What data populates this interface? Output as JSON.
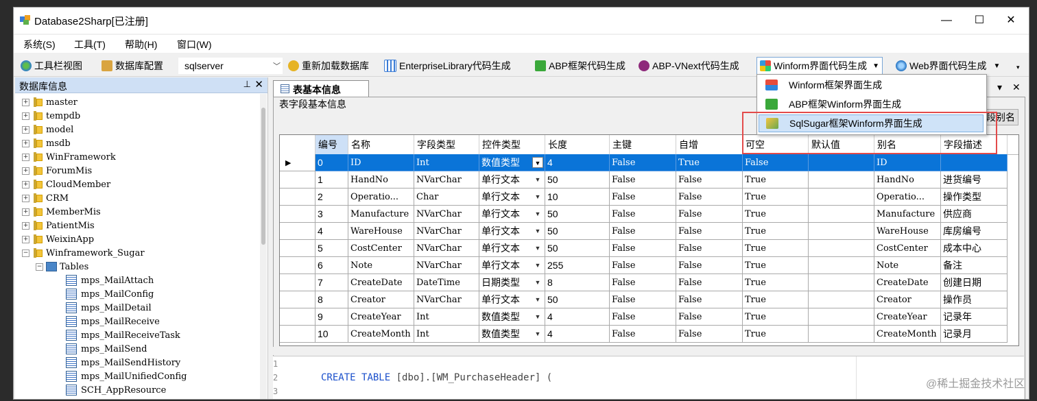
{
  "window": {
    "title": "Database2Sharp[已注册]",
    "min": "—",
    "max": "☐",
    "close": "✕"
  },
  "menu": [
    "系统(S)",
    "工具(T)",
    "帮助(H)",
    "窗口(W)"
  ],
  "toolbar": {
    "toolbar_view": "工具栏视图",
    "db_config": "数据库配置",
    "db_type": "sqlserver",
    "reload": "重新加载数据库",
    "enterprise": "EnterpriseLibrary代码生成",
    "abp": "ABP框架代码生成",
    "abp_vnext": "ABP-VNext代码生成",
    "winform": "Winform界面代码生成",
    "web": "Web界面代码生成"
  },
  "dropdown_items": [
    "Winform框架界面生成",
    "ABP框架Winform界面生成",
    "SqlSugar框架Winform界面生成"
  ],
  "left_panel": {
    "title": "数据库信息",
    "pin": "⊥",
    "close": "✕",
    "databases": [
      "master",
      "tempdb",
      "model",
      "msdb",
      "WinFramework",
      "ForumMis",
      "CloudMember",
      "CRM",
      "MemberMis",
      "PatientMis",
      "WeixinApp",
      "Winframework_Sugar"
    ],
    "tables_node": "Tables",
    "tables": [
      "mps_MailAttach",
      "mps_MailConfig",
      "mps_MailDetail",
      "mps_MailReceive",
      "mps_MailReceiveTask",
      "mps_MailSend",
      "mps_MailSendHistory",
      "mps_MailUnifiedConfig",
      "SCH_AppResource"
    ]
  },
  "tab": {
    "label": "表基本信息",
    "ctrl_down": "▾",
    "ctrl_close": "✕"
  },
  "group_title": "表字段基本信息",
  "alias_button": "字段别名",
  "grid": {
    "columns": [
      "编号",
      "名称",
      "字段类型",
      "控件类型",
      "长度",
      "主键",
      "自增",
      "可空",
      "默认值",
      "别名",
      "字段描述"
    ],
    "rows": [
      [
        "0",
        "ID",
        "Int",
        "数值类型",
        "4",
        "False",
        "True",
        "False",
        "",
        "ID",
        ""
      ],
      [
        "1",
        "HandNo",
        "NVarChar",
        "单行文本",
        "50",
        "False",
        "False",
        "True",
        "",
        "HandNo",
        "进货编号"
      ],
      [
        "2",
        "Operatio...",
        "Char",
        "单行文本",
        "10",
        "False",
        "False",
        "True",
        "",
        "Operatio...",
        "操作类型"
      ],
      [
        "3",
        "Manufacture",
        "NVarChar",
        "单行文本",
        "50",
        "False",
        "False",
        "True",
        "",
        "Manufacture",
        "供应商"
      ],
      [
        "4",
        "WareHouse",
        "NVarChar",
        "单行文本",
        "50",
        "False",
        "False",
        "True",
        "",
        "WareHouse",
        "库房编号"
      ],
      [
        "5",
        "CostCenter",
        "NVarChar",
        "单行文本",
        "50",
        "False",
        "False",
        "True",
        "",
        "CostCenter",
        "成本中心"
      ],
      [
        "6",
        "Note",
        "NVarChar",
        "单行文本",
        "255",
        "False",
        "False",
        "True",
        "",
        "Note",
        "备注"
      ],
      [
        "7",
        "CreateDate",
        "DateTime",
        "日期类型",
        "8",
        "False",
        "False",
        "True",
        "",
        "CreateDate",
        "创建日期"
      ],
      [
        "8",
        "Creator",
        "NVarChar",
        "单行文本",
        "50",
        "False",
        "False",
        "True",
        "",
        "Creator",
        "操作员"
      ],
      [
        "9",
        "CreateYear",
        "Int",
        "数值类型",
        "4",
        "False",
        "False",
        "True",
        "",
        "CreateYear",
        "记录年"
      ],
      [
        "10",
        "CreateMonth",
        "Int",
        "数值类型",
        "4",
        "False",
        "False",
        "True",
        "",
        "CreateMonth",
        "记录月"
      ]
    ]
  },
  "code": {
    "line_numbers": [
      "1",
      "2",
      "3"
    ],
    "kw1": "CREATE",
    "kw2": "TABLE",
    "rest": " [dbo].[WM_PurchaseHeader] ("
  },
  "watermark": "@稀土掘金技术社区",
  "colors": {
    "selection": "#0a74d8",
    "highlight_box": "#e34a4a",
    "panel_header": "#cfe0f5"
  }
}
